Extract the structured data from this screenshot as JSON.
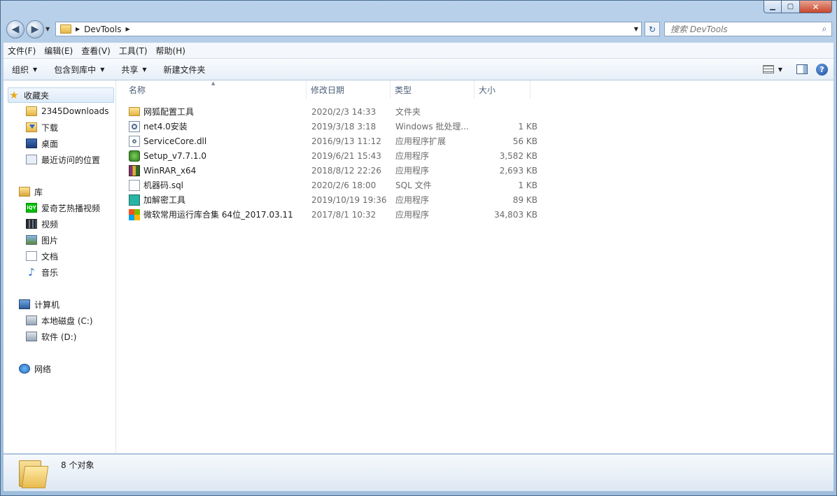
{
  "address": {
    "path": "DevTools"
  },
  "search": {
    "placeholder": "搜索 DevTools"
  },
  "menu": [
    "文件(F)",
    "编辑(E)",
    "查看(V)",
    "工具(T)",
    "帮助(H)"
  ],
  "toolbar": {
    "organize": "组织",
    "include_library": "包含到库中",
    "share": "共享",
    "new_folder": "新建文件夹"
  },
  "nav": {
    "favorites": {
      "label": "收藏夹",
      "items": [
        "2345Downloads",
        "下载",
        "桌面",
        "最近访问的位置"
      ]
    },
    "libraries": {
      "label": "库",
      "items": [
        "爱奇艺热播视频",
        "视频",
        "图片",
        "文档",
        "音乐"
      ]
    },
    "computer": {
      "label": "计算机",
      "items": [
        "本地磁盘 (C:)",
        "软件 (D:)"
      ]
    },
    "network": {
      "label": "网络"
    }
  },
  "columns": {
    "name": "名称",
    "date": "修改日期",
    "type": "类型",
    "size": "大小"
  },
  "files": [
    {
      "name": "网狐配置工具",
      "date": "2020/2/3 14:33",
      "type": "文件夹",
      "size": "",
      "icon": "folder-icon"
    },
    {
      "name": "net4.0安装",
      "date": "2019/3/18 3:18",
      "type": "Windows 批处理...",
      "size": "1 KB",
      "icon": "batch-file-icon"
    },
    {
      "name": "ServiceCore.dll",
      "date": "2016/9/13 11:12",
      "type": "应用程序扩展",
      "size": "56 KB",
      "icon": "dll-file-icon"
    },
    {
      "name": "Setup_v7.7.1.0",
      "date": "2019/6/21 15:43",
      "type": "应用程序",
      "size": "3,582 KB",
      "icon": "setup-app-icon"
    },
    {
      "name": "WinRAR_x64",
      "date": "2018/8/12 22:26",
      "type": "应用程序",
      "size": "2,693 KB",
      "icon": "winrar-icon"
    },
    {
      "name": "机器码.sql",
      "date": "2020/2/6 18:00",
      "type": "SQL 文件",
      "size": "1 KB",
      "icon": "sql-file-icon"
    },
    {
      "name": "加解密工具",
      "date": "2019/10/19 19:36",
      "type": "应用程序",
      "size": "89 KB",
      "icon": "crypto-tool-icon"
    },
    {
      "name": "微软常用运行库合集 64位_2017.03.11",
      "date": "2017/8/1 10:32",
      "type": "应用程序",
      "size": "34,803 KB",
      "icon": "microsoft-logo-icon"
    }
  ],
  "status": {
    "count": "8 个对象"
  }
}
